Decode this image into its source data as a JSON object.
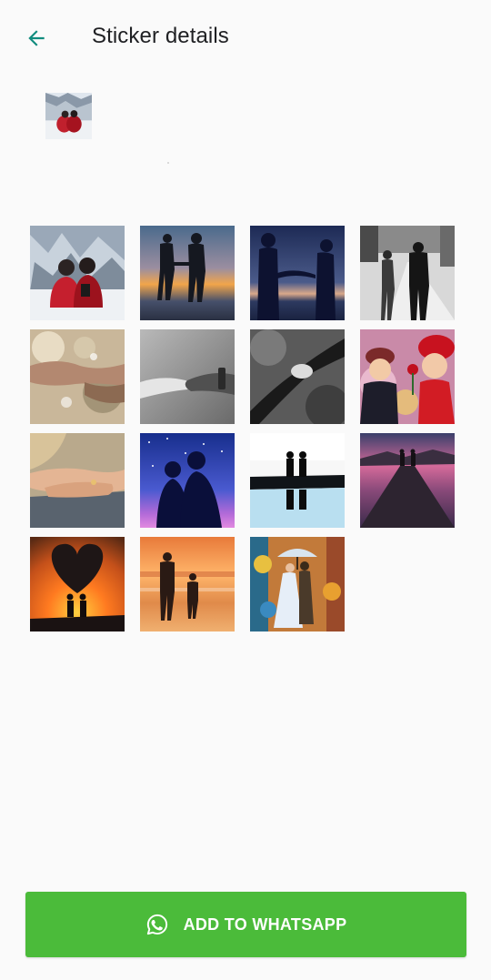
{
  "header": {
    "back_icon": "arrow-back-icon",
    "title": "Sticker details"
  },
  "tray_icon": "couple-on-snow-thumbnail",
  "stickers": [
    {
      "subject": "couple-in-snow"
    },
    {
      "subject": "couple-silhouette-sunset"
    },
    {
      "subject": "couple-holding-hands-dusk"
    },
    {
      "subject": "couple-walking-street"
    },
    {
      "subject": "hands-sparkles"
    },
    {
      "subject": "hands-touching-grayscale"
    },
    {
      "subject": "hands-holding-grayscale"
    },
    {
      "subject": "kids-with-rose"
    },
    {
      "subject": "hands-clasped"
    },
    {
      "subject": "couple-starry-night"
    },
    {
      "subject": "couple-reflection-water"
    },
    {
      "subject": "couple-on-pier"
    },
    {
      "subject": "heart-tree-sunset"
    },
    {
      "subject": "couple-beach-sunset"
    },
    {
      "subject": "couple-umbrella-painting"
    }
  ],
  "add_button": {
    "icon": "whatsapp-icon",
    "label": "ADD TO WHATSAPP",
    "color": "#4bbb3a"
  },
  "colors": {
    "accent": "#128c7e",
    "background": "#fafafa"
  }
}
